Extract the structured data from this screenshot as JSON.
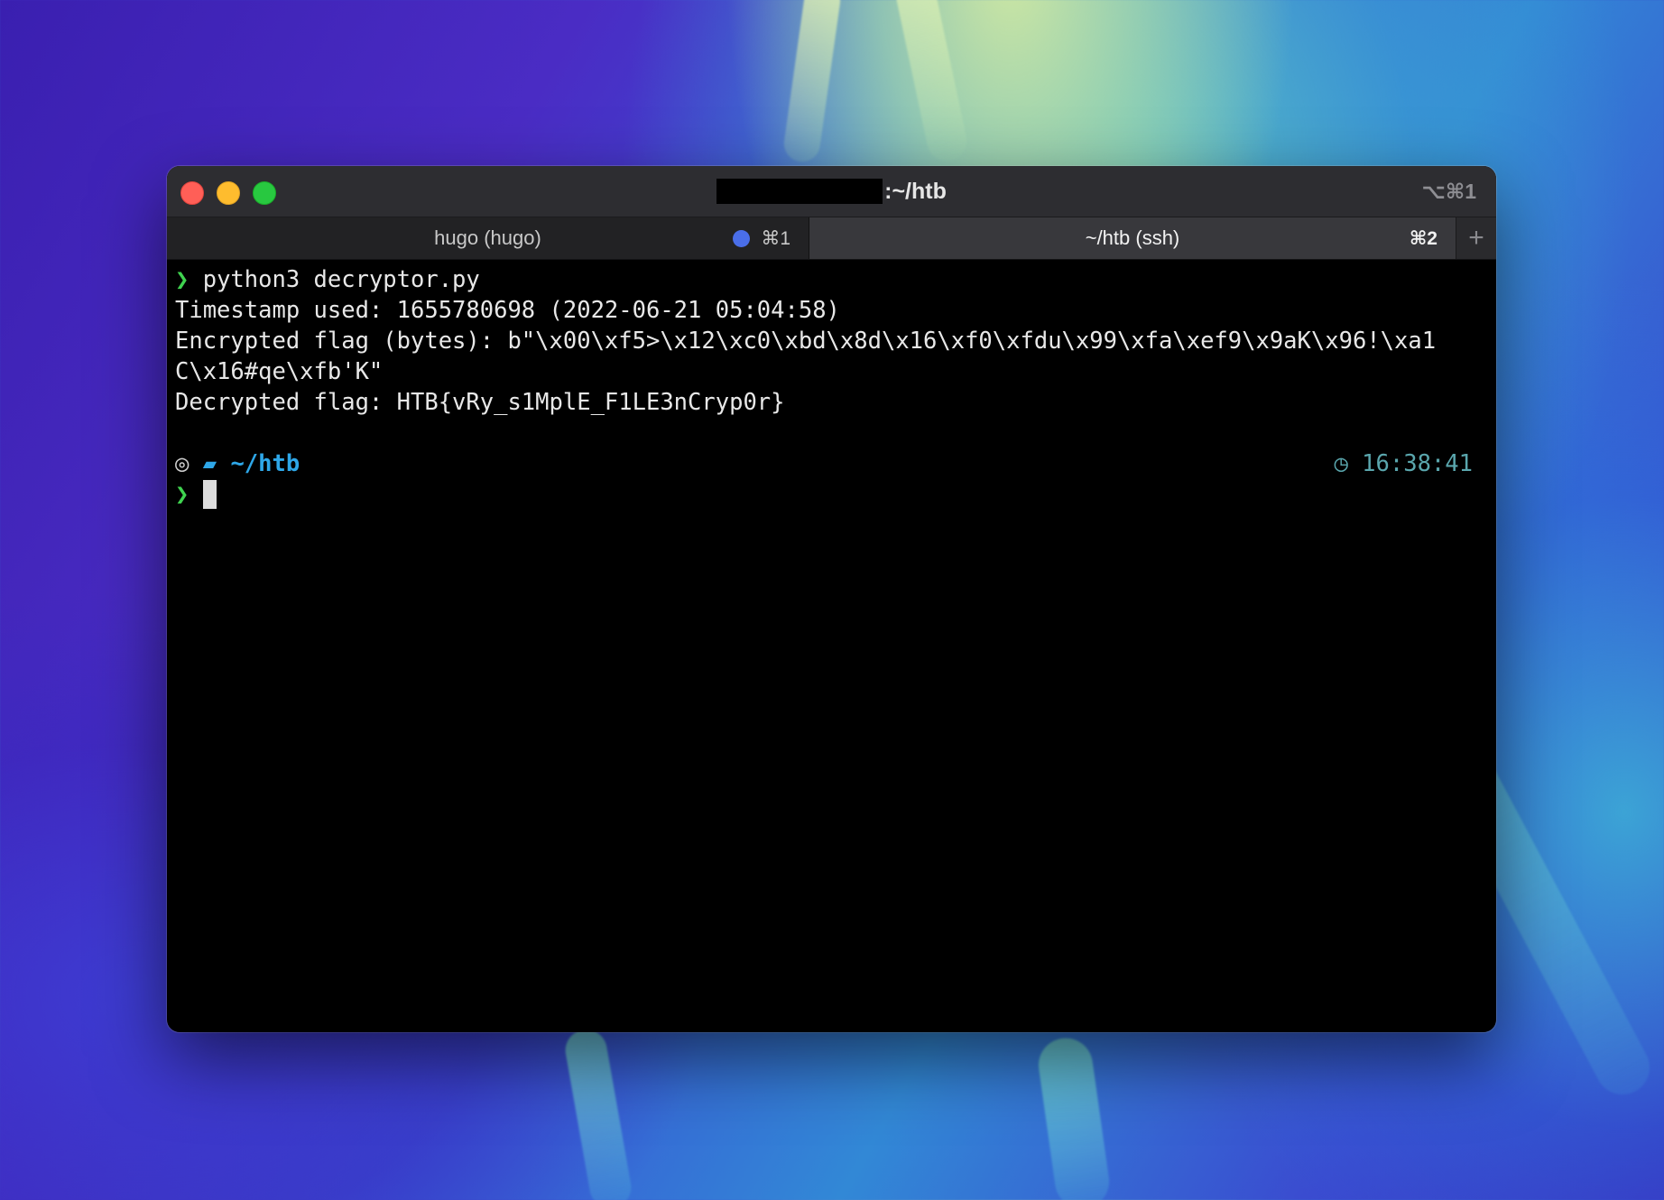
{
  "window": {
    "title_suffix": ":~/htb",
    "title_shortcut": "⌥⌘1"
  },
  "tabs": [
    {
      "label": "hugo (hugo)",
      "shortcut": "⌘1",
      "has_dot": true,
      "active": false
    },
    {
      "label": "~/htb (ssh)",
      "shortcut": "⌘2",
      "active": true
    }
  ],
  "new_tab_glyph": "+",
  "terminal": {
    "prompt_symbol": "❯",
    "command": "python3 decryptor.py",
    "output": [
      "Timestamp used: 1655780698 (2022-06-21 05:04:58)",
      "Encrypted flag (bytes): b\"\\x00\\xf5>\\x12\\xc0\\xbd\\x8d\\x16\\xf0\\xfdu\\x99\\xfa\\xef9\\x9aK\\x96!\\xa1",
      "C\\x16#qe\\xfb'K\"",
      "Decrypted flag: HTB{vRy_s1MplE_F1LE3nCryp0r}"
    ],
    "os_icon": "◎",
    "folder_icon": "▰",
    "cwd": "~/htb",
    "clock_icon": "◷",
    "time": "16:38:41"
  },
  "colors": {
    "prompt_green": "#3fd34f",
    "path_blue": "#2ea7e8",
    "tab_dot_blue": "#4a6ee8"
  }
}
